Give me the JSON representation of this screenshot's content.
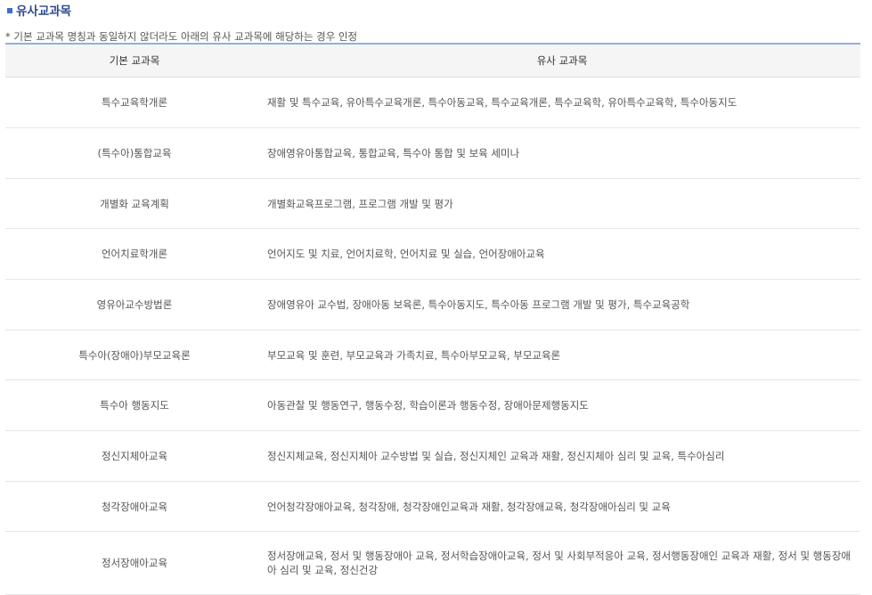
{
  "section": {
    "title": "유사교과목",
    "accent_color": "#2f4a8f"
  },
  "note": "* 기본 교과목 명칭과 동일하지 않더라도 아래의 유사 교과목에 해당하는 경우 인정",
  "table": {
    "headers": [
      "기본 교과목",
      "유사 교과목"
    ],
    "rows": [
      {
        "basic": "특수교육학개론",
        "similar": "재활 및 특수교육, 유아특수교육개론, 특수아동교육, 특수교육개론, 특수교육학, 유아특수교육학, 특수아동지도"
      },
      {
        "basic": "(특수아)통합교육",
        "similar": "장애영유아통합교육, 통합교육, 특수아 통합 및 보육 세미나"
      },
      {
        "basic": "개별화 교육계획",
        "similar": "개별화교육프로그램, 프로그램 개발 및 평가"
      },
      {
        "basic": "언어치료학개론",
        "similar": "언어지도 및 치료, 언어치료학, 언어치료 및 실습, 언어장애아교육"
      },
      {
        "basic": "영유아교수방법론",
        "similar": "장애영유아 교수법, 장애아동 보육론, 특수아동지도, 특수아동 프로그램 개발 및 평가, 특수교육공학"
      },
      {
        "basic": "특수아(장애아)부모교육론",
        "similar": "부모교육 및 훈련, 부모교육과 가족치료, 특수아부모교육, 부모교육론"
      },
      {
        "basic": "특수아 행동지도",
        "similar": "아동관찰 및 행동연구, 행동수정, 학습이론과 행동수정, 장애아문제행동지도"
      },
      {
        "basic": "정신지체아교육",
        "similar": "정신지체교육, 정신지체아 교수방법 및 실습, 정신지체인 교육과 재활, 정신지체아 심리 및 교육, 특수아심리"
      },
      {
        "basic": "청각장애아교육",
        "similar": "언어청각장애아교육, 청각장애, 청각장애인교육과 재활, 청각장애교육, 청각장애아심리 및 교육"
      },
      {
        "basic": "정서장애아교육",
        "similar": "정서장애교육, 정서 및 행동장애아 교육, 정서학습장애아교육, 정서 및 사회부적응아 교육, 정서행동장애인 교육과 재활, 정서 및 행동장애아 심리 및 교육, 정신건강"
      }
    ]
  }
}
